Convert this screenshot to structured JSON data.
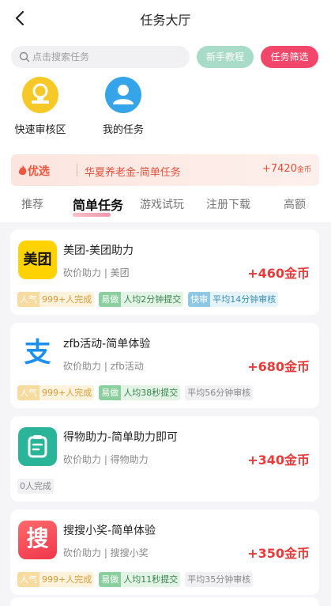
{
  "header": {
    "title": "任务大厅"
  },
  "search": {
    "placeholder": "点击搜索任务"
  },
  "buttons": {
    "tutorial": "新手教程",
    "filter": "任务筛选"
  },
  "quick_links": [
    {
      "label": "快速审核区",
      "icon": "medal-icon"
    },
    {
      "label": "我的任务",
      "icon": "user-icon"
    }
  ],
  "promo": {
    "badge": "优选",
    "title": "华夏养老金-简单任务",
    "reward_amount": "+7420",
    "reward_unit": "金币"
  },
  "tabs": [
    "推荐",
    "简单任务",
    "游戏试玩",
    "注册下载",
    "高额"
  ],
  "active_tab": "简单任务",
  "tasks": [
    {
      "title": "美团-美团助力",
      "subtitle": "砍价助力 | 美团",
      "reward": "+460金币",
      "logo_text": "美团",
      "tags": [
        [
          "人气",
          "999+人完成"
        ],
        [
          "易做",
          "人均2分钟提交"
        ],
        [
          "快审",
          "平均14分钟审核"
        ]
      ]
    },
    {
      "title": "zfb活动-简单体验",
      "subtitle": "砍价助力 | zfb活动",
      "reward": "+680金币",
      "logo_text": "支",
      "tags": [
        [
          "人气",
          "999+人完成"
        ],
        [
          "易做",
          "人均38秒提交"
        ],
        [
          "",
          "平均56分钟审核"
        ]
      ]
    },
    {
      "title": "得物助力-简单助力即可",
      "subtitle": "砍价助力 | 得物助力",
      "reward": "+340金币",
      "logo_text": "",
      "tags": [
        [
          "",
          "0人完成"
        ]
      ]
    },
    {
      "title": "搜搜小奖-简单体验",
      "subtitle": "砍价助力 | 搜搜小奖",
      "reward": "+350金币",
      "logo_text": "搜",
      "tags": [
        [
          "人气",
          "999+人完成"
        ],
        [
          "易做",
          "人均11秒提交"
        ],
        [
          "",
          "平均35分钟审核"
        ]
      ]
    }
  ],
  "colors": {
    "accent": "#f2476a",
    "reward": "#ea3a3a",
    "tutorial": "#a8dcc9"
  }
}
